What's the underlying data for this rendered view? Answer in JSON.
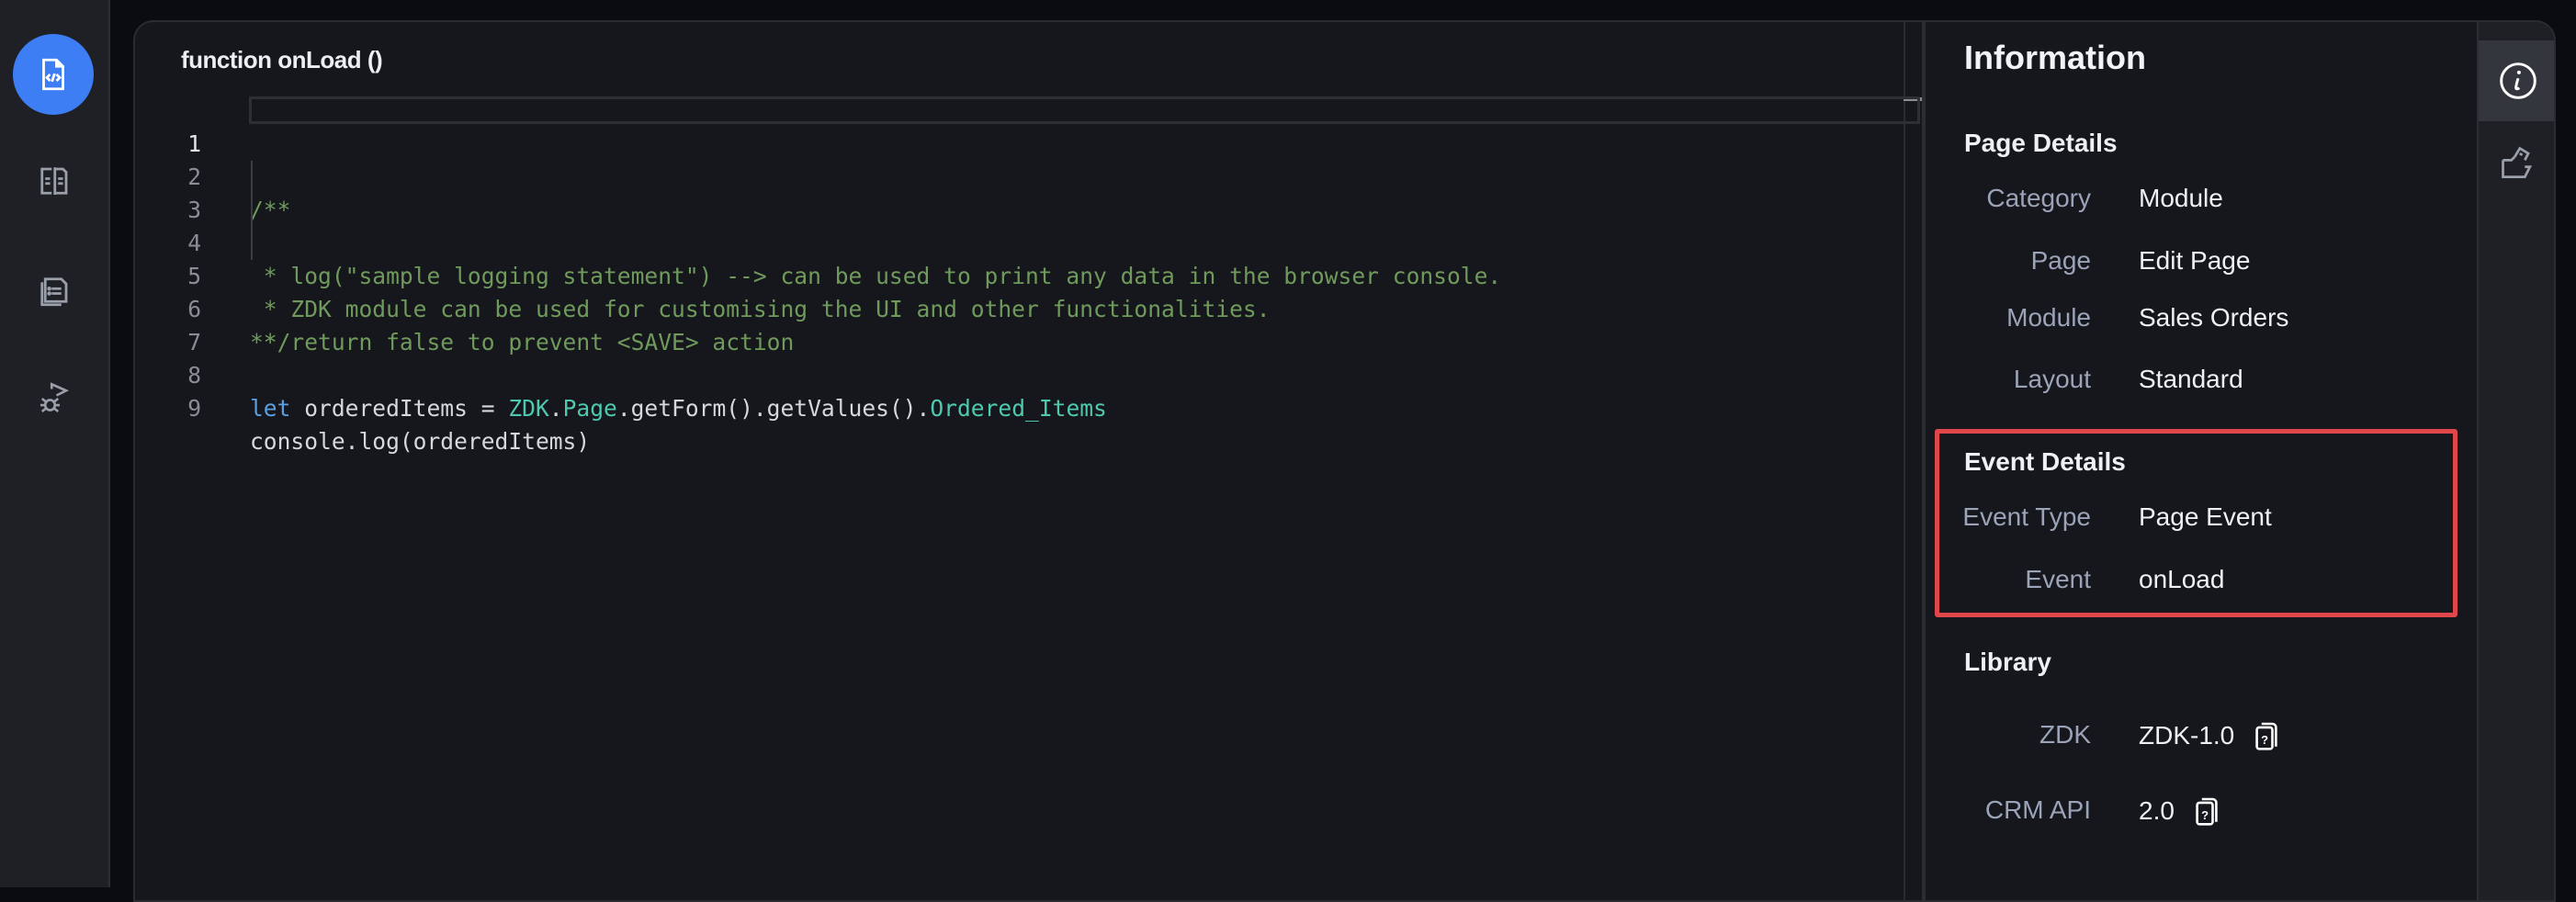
{
  "sidebar": {
    "items": [
      {
        "icon": "code-file-icon",
        "active": true
      },
      {
        "icon": "split-document-icon",
        "active": false
      },
      {
        "icon": "document-list-icon",
        "active": false
      },
      {
        "icon": "debug-run-icon",
        "active": false
      }
    ]
  },
  "editor": {
    "function_title": "function onLoad ()",
    "lines": [
      {
        "num": "1"
      },
      {
        "num": "2",
        "text": "/**"
      },
      {
        "num": "3",
        "text": " * log(\"sample logging statement\") --> can be used to print any data in the browser console."
      },
      {
        "num": "4",
        "text": " * ZDK module can be used for customising the UI and other functionalities."
      },
      {
        "num": "5",
        "text": " * return false to prevent <SAVE> action"
      },
      {
        "num": "6",
        "text": "**/"
      },
      {
        "num": "7"
      },
      {
        "num": "8",
        "tokens": {
          "kw": "let",
          "plain1": " orderedItems = ",
          "zdk": "ZDK",
          "dot1": ".",
          "page": "Page",
          "plain2": ".getForm().getValues().",
          "field": "Ordered_Items"
        }
      },
      {
        "num": "9",
        "text": "console.log(orderedItems)"
      }
    ]
  },
  "info": {
    "title": "Information",
    "page_details": {
      "heading": "Page Details",
      "rows": [
        {
          "label": "Category",
          "value": "Module"
        },
        {
          "label": "Page",
          "value": "Edit Page"
        },
        {
          "label": "Module",
          "value": "Sales Orders"
        },
        {
          "label": "Layout",
          "value": "Standard"
        }
      ]
    },
    "event_details": {
      "heading": "Event Details",
      "rows": [
        {
          "label": "Event Type",
          "value": "Page Event"
        },
        {
          "label": "Event",
          "value": "onLoad"
        }
      ]
    },
    "library": {
      "heading": "Library",
      "rows": [
        {
          "label": "ZDK",
          "value": "ZDK-1.0"
        },
        {
          "label": "CRM API",
          "value": "2.0"
        }
      ]
    }
  },
  "rail": {
    "items": [
      {
        "icon": "info-icon",
        "active": true
      },
      {
        "icon": "folder-icon",
        "active": false
      }
    ]
  },
  "colors": {
    "accent": "#3d7ef5",
    "highlight_box": "#e0474b",
    "comment": "#6f9a5c",
    "keyword": "#5aa0e0",
    "type": "#4ec9b0"
  }
}
